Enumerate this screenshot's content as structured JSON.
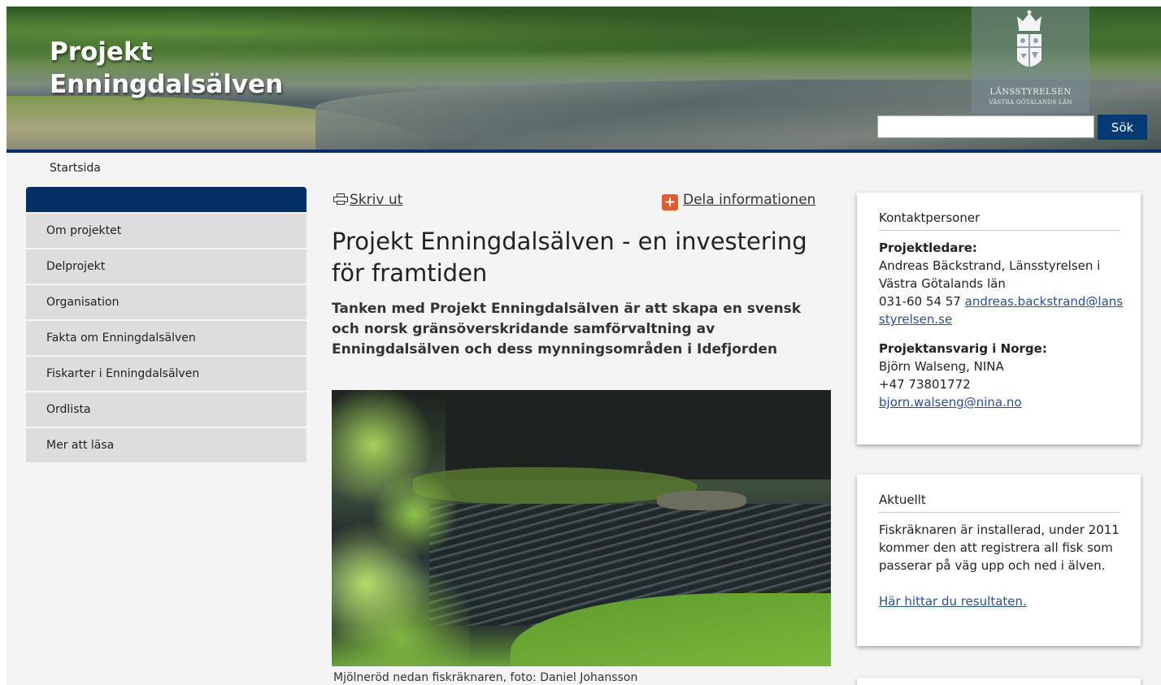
{
  "site": {
    "title_line1": "Projekt",
    "title_line2": "Enningdalsälven",
    "authority_name": "LÄNSSTYRELSEN",
    "authority_sub": "VÄSTRA GÖTALANDS LÄN"
  },
  "search": {
    "value": "",
    "button_label": "Sök"
  },
  "breadcrumb": "Startsida",
  "nav": {
    "items": [
      {
        "label": "Om projektet"
      },
      {
        "label": "Delprojekt"
      },
      {
        "label": "Organisation"
      },
      {
        "label": "Fakta om Enningdalsälven"
      },
      {
        "label": "Fiskarter i Enningdalsälven"
      },
      {
        "label": "Ordlista"
      },
      {
        "label": "Mer att läsa"
      }
    ]
  },
  "tools": {
    "print_label": "Skriv ut",
    "share_label": "Dela informationen"
  },
  "article": {
    "title": "Projekt Enningdalsälven - en investering för framtiden",
    "lead": "Tanken med Projekt Enningdalsälven är att skapa en svensk och norsk gränsöverskridande samförvaltning av Enningdalsälven och dess mynningsområden i Idefjorden",
    "image_caption": "Mjölneröd nedan fiskräknaren, foto: Daniel Johansson"
  },
  "contacts": {
    "heading": "Kontaktpersoner",
    "project_leader": {
      "role": "Projektledare:",
      "name_org": "Andreas Bäckstrand, Länsstyrelsen i Västra Götalands län",
      "phone": "031-60 54 57",
      "email": "andreas.backstrand@lansstyrelsen.se"
    },
    "norway": {
      "role": "Projektansvarig i Norge:",
      "name_org": "Björn Walseng, NINA",
      "phone": "+47 73801772",
      "email": "bjorn.walseng@nina.no"
    }
  },
  "news": {
    "heading": "Aktuellt",
    "text": "Fiskräknaren är installerad, under 2011 kommer den att registrera all fisk som passerar på väg upp och ned i älven.",
    "link": "Här hittar du resultaten."
  },
  "colors": {
    "nav_header": "#042f67",
    "search_button": "#053b74",
    "share_icon": "#e45c2b",
    "link": "#2a4da0"
  }
}
